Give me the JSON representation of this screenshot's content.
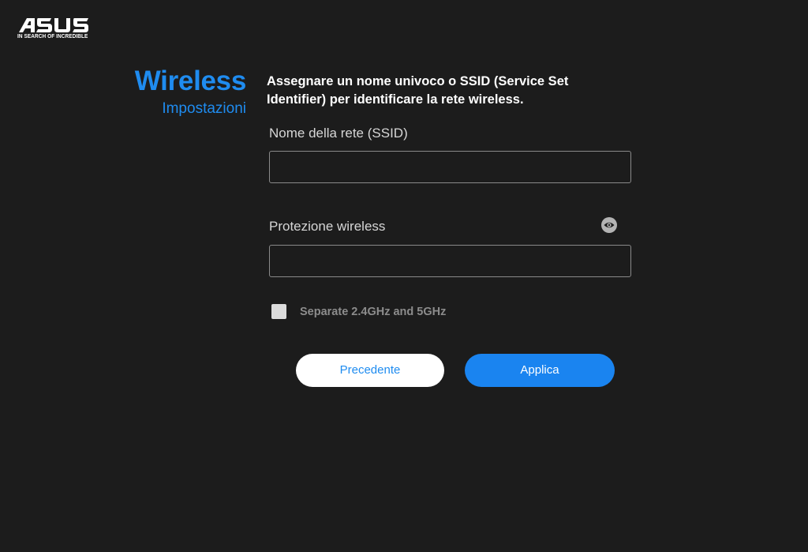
{
  "brand": {
    "logo_text": "ASUS",
    "tagline": "IN SEARCH OF INCREDIBLE"
  },
  "header": {
    "title": "Wireless",
    "subtitle": "Impostazioni"
  },
  "main": {
    "description": "Assegnare un nome univoco o SSID (Service Set Identifier) per identificare la rete wireless.",
    "ssid_field": {
      "label": "Nome della rete (SSID)",
      "value": "",
      "placeholder": ""
    },
    "security_field": {
      "label": "Protezione wireless",
      "value": "",
      "placeholder": "",
      "toggle_icon": "eye-icon"
    },
    "separate_bands": {
      "label": "Separate 2.4GHz and 5GHz",
      "checked": false
    }
  },
  "actions": {
    "back_label": "Precedente",
    "apply_label": "Applica"
  },
  "colors": {
    "background": "#1c1c1c",
    "accent": "#1f8cf0",
    "apply_button": "#1a84f0",
    "text": "#ffffff",
    "muted_text": "#8c8c8c"
  }
}
